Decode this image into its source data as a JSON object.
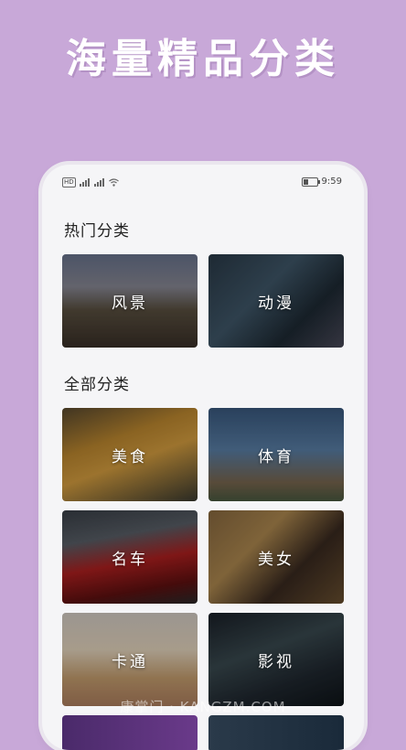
{
  "banner": {
    "title": "海量精品分类"
  },
  "statusbar": {
    "time": "9:59",
    "hd": "HD"
  },
  "hot": {
    "title": "热门分类",
    "items": [
      {
        "label": "风景"
      },
      {
        "label": "动漫"
      }
    ]
  },
  "all": {
    "title": "全部分类",
    "items": [
      {
        "label": "美食"
      },
      {
        "label": "体育"
      },
      {
        "label": "名车"
      },
      {
        "label": "美女"
      },
      {
        "label": "卡通"
      },
      {
        "label": "影视"
      }
    ]
  },
  "watermark": "康掌门 · KANGZM.COM",
  "colors": {
    "background": "#c8a8d8",
    "phone_bg": "#f5f5f7",
    "card_text": "#ffffff"
  }
}
